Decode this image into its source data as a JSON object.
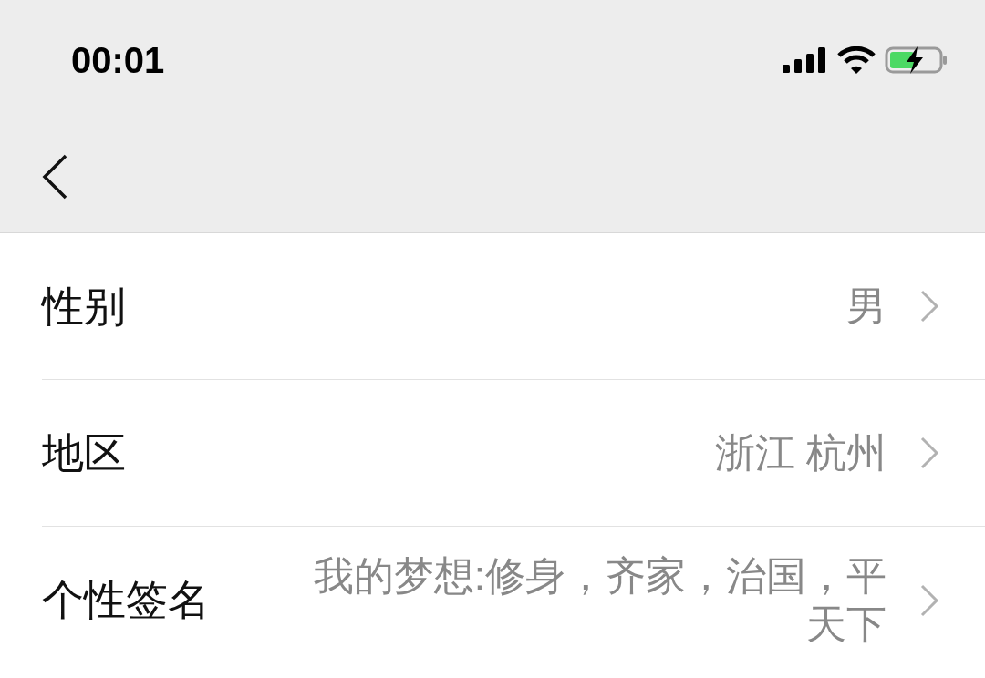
{
  "status_bar": {
    "time": "00:01"
  },
  "rows": [
    {
      "label": "性别",
      "value": "男"
    },
    {
      "label": "地区",
      "value": "浙江 杭州"
    },
    {
      "label": "个性签名",
      "value": "我的梦想:修身，齐家，治国，平天下"
    }
  ]
}
